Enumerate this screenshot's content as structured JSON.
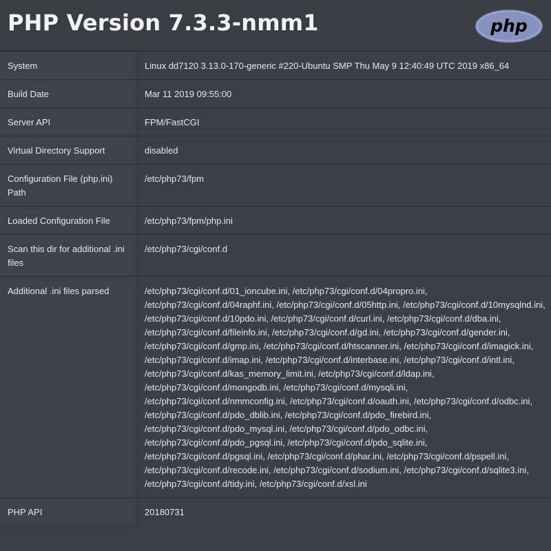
{
  "header": {
    "title": "PHP Version 7.3.3-nmm1",
    "logo_text": "php"
  },
  "rows": [
    {
      "key": "System",
      "value": "Linux dd7120 3.13.0-170-generic #220-Ubuntu SMP Thu May 9 12:40:49 UTC 2019 x86_64"
    },
    {
      "key": "Build Date",
      "value": "Mar 11 2019 09:55:00"
    },
    {
      "key": "Server API",
      "value": "FPM/FastCGI"
    },
    {
      "key": "Virtual Directory Support",
      "value": "disabled"
    },
    {
      "key": "Configuration File (php.ini) Path",
      "value": "/etc/php73/fpm"
    },
    {
      "key": "Loaded Configuration File",
      "value": "/etc/php73/fpm/php.ini"
    },
    {
      "key": "Scan this dir for additional .ini files",
      "value": "/etc/php73/cgi/conf.d"
    },
    {
      "key": "Additional .ini files parsed",
      "value": "/etc/php73/cgi/conf.d/01_ioncube.ini, /etc/php73/cgi/conf.d/04propro.ini, /etc/php73/cgi/conf.d/04raphf.ini, /etc/php73/cgi/conf.d/05http.ini, /etc/php73/cgi/conf.d/10mysqlnd.ini, /etc/php73/cgi/conf.d/10pdo.ini, /etc/php73/cgi/conf.d/curl.ini, /etc/php73/cgi/conf.d/dba.ini, /etc/php73/cgi/conf.d/fileinfo.ini, /etc/php73/cgi/conf.d/gd.ini, /etc/php73/cgi/conf.d/gender.ini, /etc/php73/cgi/conf.d/gmp.ini, /etc/php73/cgi/conf.d/htscanner.ini, /etc/php73/cgi/conf.d/imagick.ini, /etc/php73/cgi/conf.d/imap.ini, /etc/php73/cgi/conf.d/interbase.ini, /etc/php73/cgi/conf.d/intl.ini, /etc/php73/cgi/conf.d/kas_memory_limit.ini, /etc/php73/cgi/conf.d/ldap.ini, /etc/php73/cgi/conf.d/mongodb.ini, /etc/php73/cgi/conf.d/mysqli.ini, /etc/php73/cgi/conf.d/nmmconfig.ini, /etc/php73/cgi/conf.d/oauth.ini, /etc/php73/cgi/conf.d/odbc.ini, /etc/php73/cgi/conf.d/pdo_dblib.ini, /etc/php73/cgi/conf.d/pdo_firebird.ini, /etc/php73/cgi/conf.d/pdo_mysql.ini, /etc/php73/cgi/conf.d/pdo_odbc.ini, /etc/php73/cgi/conf.d/pdo_pgsql.ini, /etc/php73/cgi/conf.d/pdo_sqlite.ini, /etc/php73/cgi/conf.d/pgsql.ini, /etc/php73/cgi/conf.d/phar.ini, /etc/php73/cgi/conf.d/pspell.ini, /etc/php73/cgi/conf.d/recode.ini, /etc/php73/cgi/conf.d/sodium.ini, /etc/php73/cgi/conf.d/sqlite3.ini, /etc/php73/cgi/conf.d/tidy.ini, /etc/php73/cgi/conf.d/xsl.ini"
    },
    {
      "key": "PHP API",
      "value": "20180731"
    }
  ],
  "colors": {
    "background": "#3c3f46",
    "key_cell": "#3f4249",
    "border": "#2f3136",
    "logo_fill": "#8892bf",
    "text": "#e8e8e8"
  }
}
